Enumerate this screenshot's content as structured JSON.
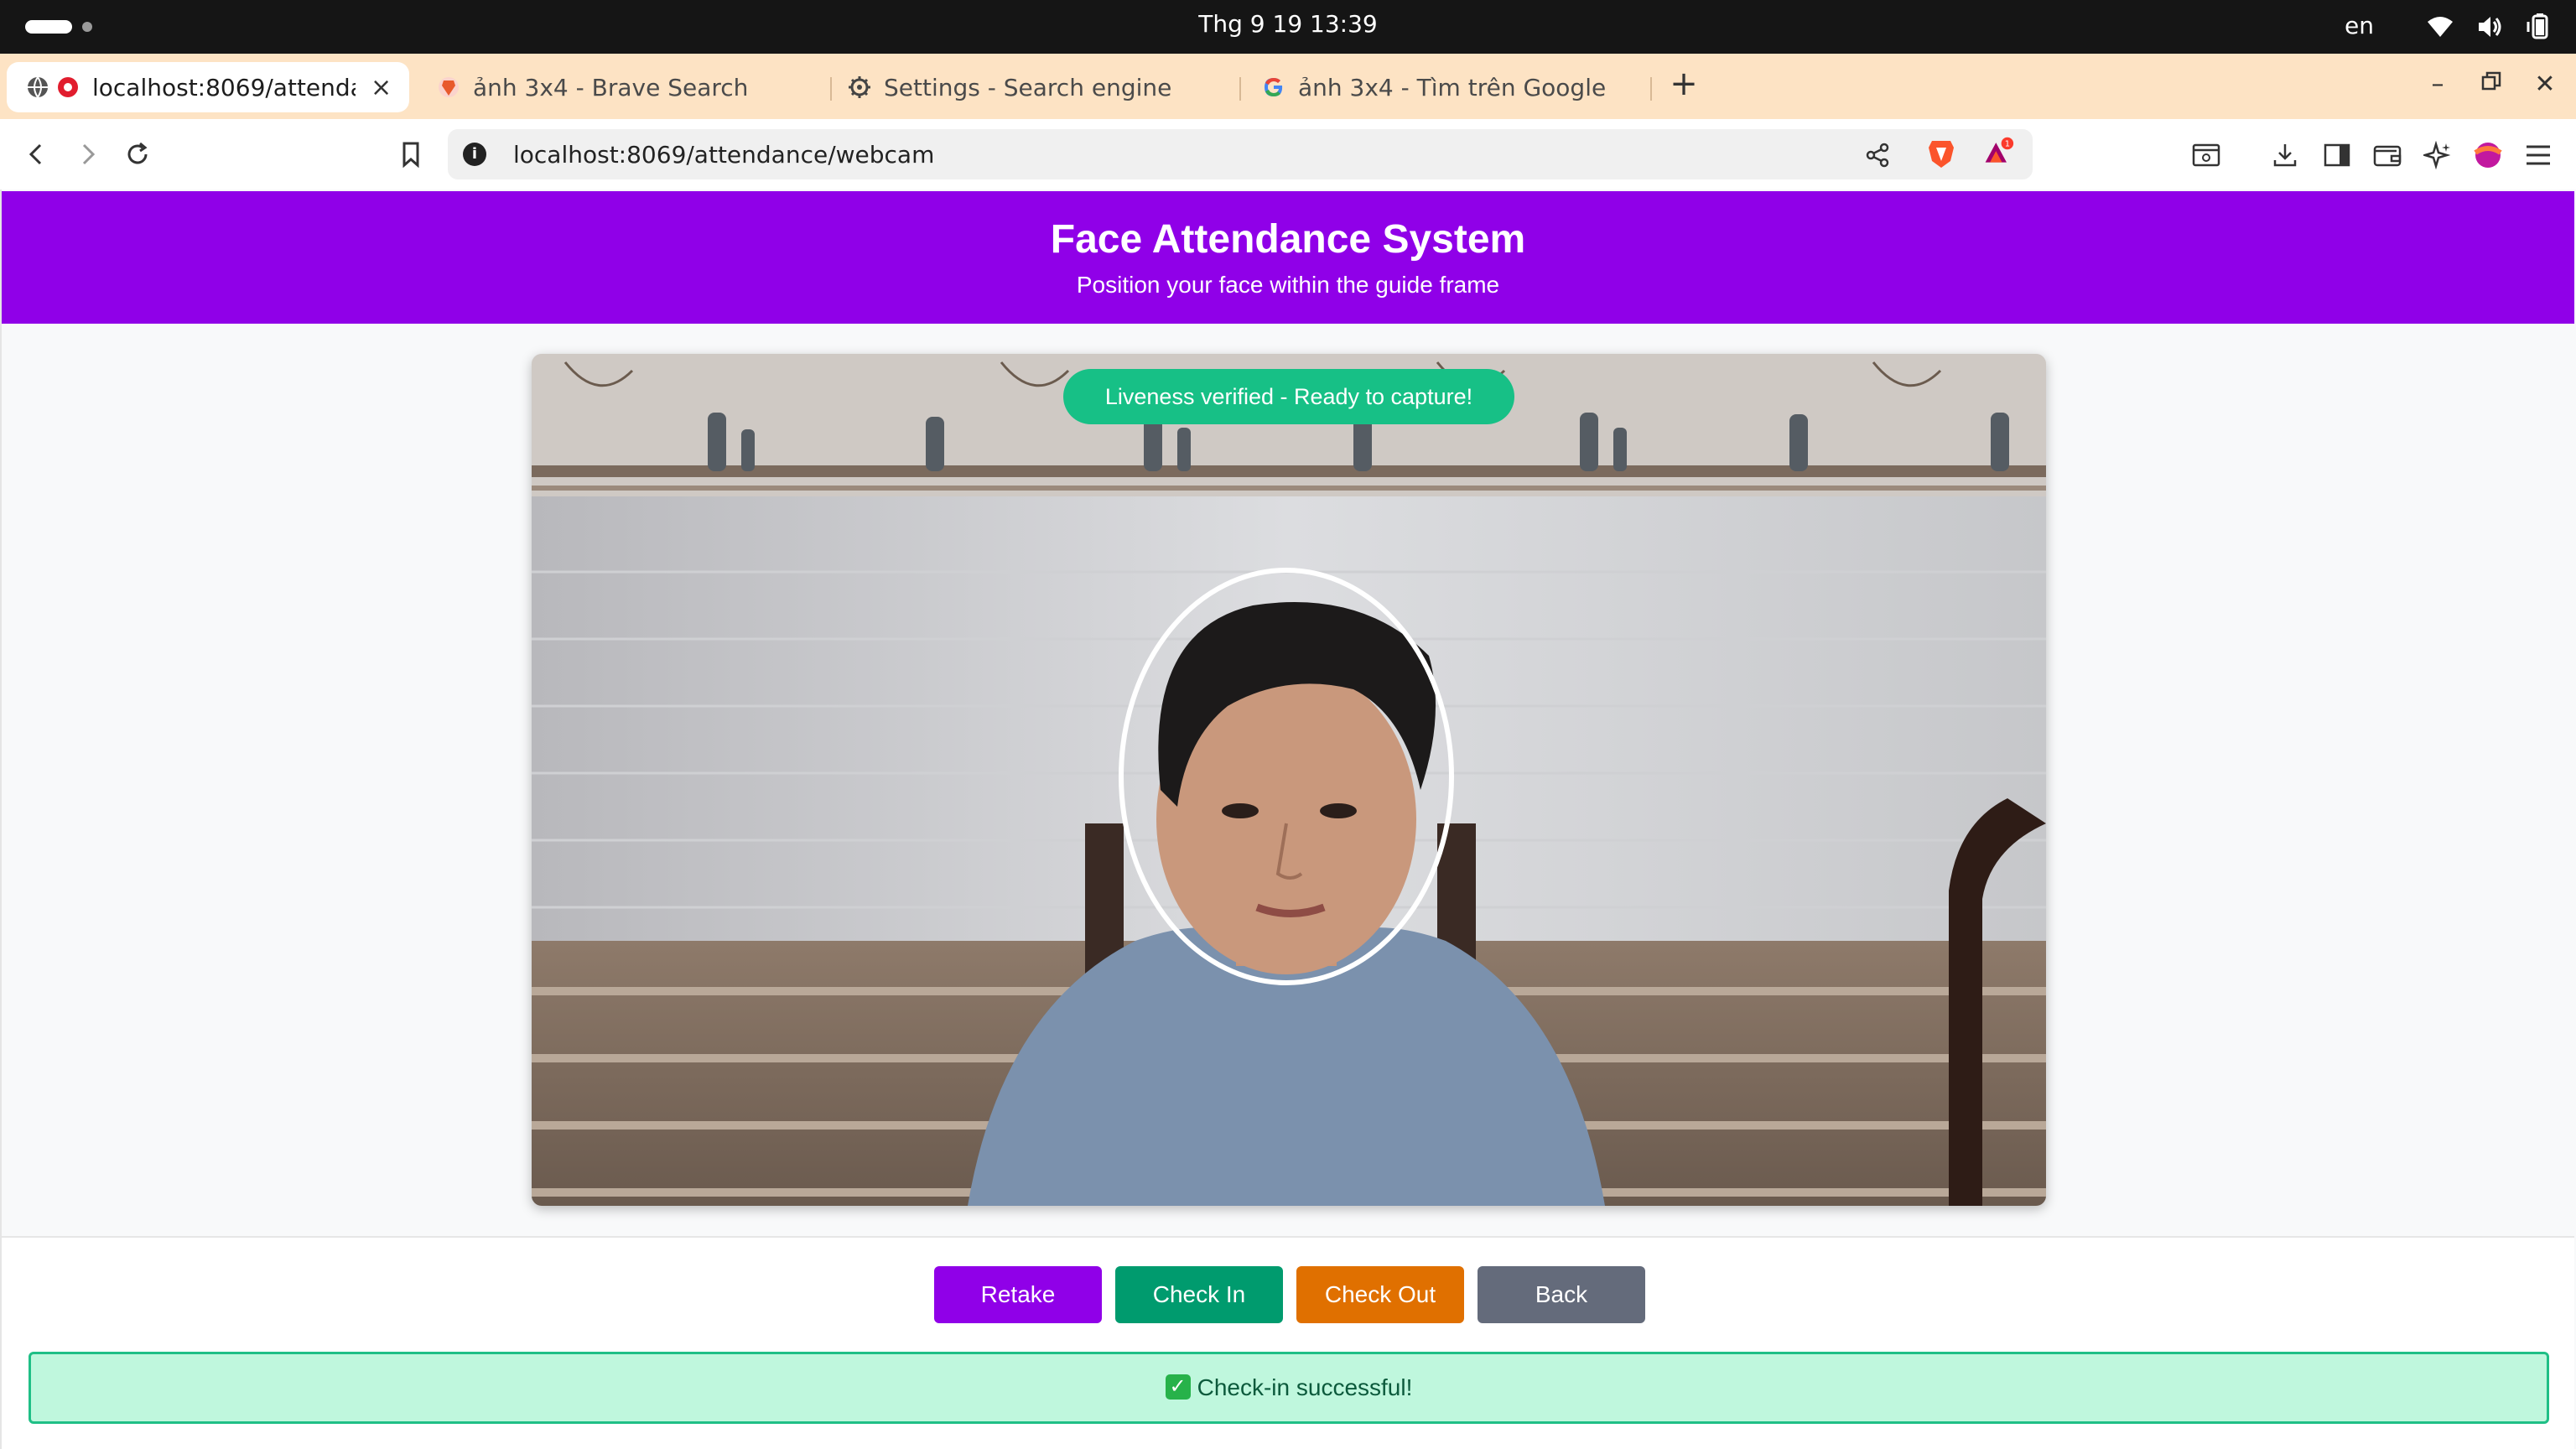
{
  "system_bar": {
    "clock": "Thg 9 19  13:39",
    "language": "en",
    "tray_icons": [
      "wifi-icon",
      "volume-icon",
      "battery-icon"
    ]
  },
  "browser": {
    "tabs": [
      {
        "label": "localhost:8069/attenda",
        "icon": "globe-recording-icon",
        "active": true
      },
      {
        "label": "ảnh 3x4 - Brave Search",
        "icon": "brave-search-icon",
        "active": false
      },
      {
        "label": "Settings - Search engine",
        "icon": "gear-icon",
        "active": false
      },
      {
        "label": "ảnh 3x4 - Tìm trên Google",
        "icon": "google-icon",
        "active": false
      }
    ],
    "url": "localhost:8069/attendance/webcam",
    "rewards_badge": "1"
  },
  "app": {
    "title": "Face Attendance System",
    "subtitle": "Position your face within the guide frame",
    "liveness_status": "Liveness verified - Ready to capture!",
    "buttons": {
      "retake": "Retake",
      "check_in": "Check In",
      "check_out": "Check Out",
      "back": "Back"
    },
    "alert": {
      "icon": "✓",
      "message": "Check-in successful!"
    }
  },
  "colors": {
    "header": "#9000e8",
    "liveness": "#17c086",
    "retake": "#9000e8",
    "check_in": "#009b6e",
    "check_out": "#e07000",
    "back": "#646b7b",
    "alert_bg": "#bff7dd",
    "alert_border": "#1fbf86"
  }
}
